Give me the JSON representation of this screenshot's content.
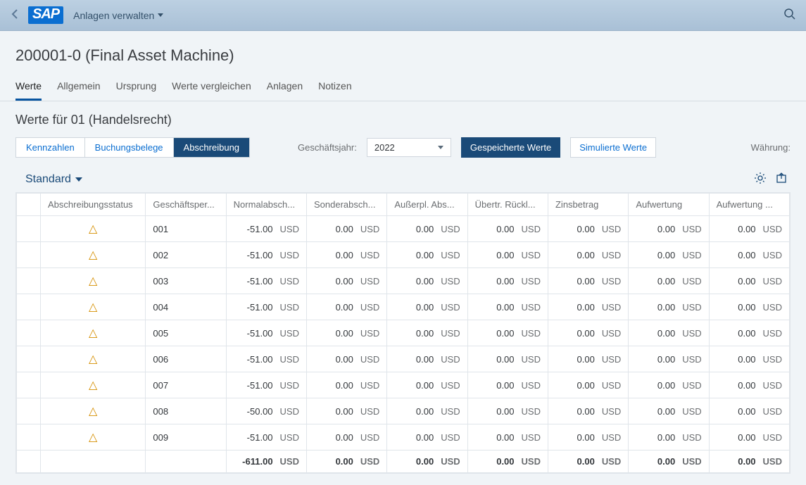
{
  "header": {
    "app_title": "Anlagen verwalten",
    "logo_text": "SAP"
  },
  "page_title": "200001-0 (Final Asset Machine)",
  "tabs": [
    {
      "id": "werte",
      "label": "Werte",
      "active": true
    },
    {
      "id": "allg",
      "label": "Allgemein",
      "active": false
    },
    {
      "id": "ursp",
      "label": "Ursprung",
      "active": false
    },
    {
      "id": "vgl",
      "label": "Werte vergleichen",
      "active": false
    },
    {
      "id": "anl",
      "label": "Anlagen",
      "active": false
    },
    {
      "id": "not",
      "label": "Notizen",
      "active": false
    }
  ],
  "section_title": "Werte für 01 (Handelsrecht)",
  "segments": [
    {
      "id": "kenn",
      "label": "Kennzahlen",
      "active": false
    },
    {
      "id": "buch",
      "label": "Buchungsbelege",
      "active": false
    },
    {
      "id": "absch",
      "label": "Abschreibung",
      "active": true
    }
  ],
  "fy": {
    "label": "Geschäftsjahr:",
    "value": "2022"
  },
  "value_modes": {
    "saved": "Gespeicherte Werte",
    "simulated": "Simulierte Werte"
  },
  "currency_label": "Währung:",
  "view": "Standard",
  "columns": [
    "",
    "Abschreibungsstatus",
    "Geschäftsper...",
    "Normalabsch...",
    "Sonderabsch...",
    "Außerpl. Abs...",
    "Übertr. Rückl...",
    "Zinsbetrag",
    "Aufwertung",
    "Aufwertung ..."
  ],
  "rows": [
    {
      "period": "001",
      "normal": "-51.00",
      "sonder": "0.00",
      "ausser": "0.00",
      "uebertr": "0.00",
      "zins": "0.00",
      "aufw": "0.00",
      "aufw2": "0.00",
      "c": "USD"
    },
    {
      "period": "002",
      "normal": "-51.00",
      "sonder": "0.00",
      "ausser": "0.00",
      "uebertr": "0.00",
      "zins": "0.00",
      "aufw": "0.00",
      "aufw2": "0.00",
      "c": "USD"
    },
    {
      "period": "003",
      "normal": "-51.00",
      "sonder": "0.00",
      "ausser": "0.00",
      "uebertr": "0.00",
      "zins": "0.00",
      "aufw": "0.00",
      "aufw2": "0.00",
      "c": "USD"
    },
    {
      "period": "004",
      "normal": "-51.00",
      "sonder": "0.00",
      "ausser": "0.00",
      "uebertr": "0.00",
      "zins": "0.00",
      "aufw": "0.00",
      "aufw2": "0.00",
      "c": "USD"
    },
    {
      "period": "005",
      "normal": "-51.00",
      "sonder": "0.00",
      "ausser": "0.00",
      "uebertr": "0.00",
      "zins": "0.00",
      "aufw": "0.00",
      "aufw2": "0.00",
      "c": "USD"
    },
    {
      "period": "006",
      "normal": "-51.00",
      "sonder": "0.00",
      "ausser": "0.00",
      "uebertr": "0.00",
      "zins": "0.00",
      "aufw": "0.00",
      "aufw2": "0.00",
      "c": "USD"
    },
    {
      "period": "007",
      "normal": "-51.00",
      "sonder": "0.00",
      "ausser": "0.00",
      "uebertr": "0.00",
      "zins": "0.00",
      "aufw": "0.00",
      "aufw2": "0.00",
      "c": "USD"
    },
    {
      "period": "008",
      "normal": "-50.00",
      "sonder": "0.00",
      "ausser": "0.00",
      "uebertr": "0.00",
      "zins": "0.00",
      "aufw": "0.00",
      "aufw2": "0.00",
      "c": "USD"
    },
    {
      "period": "009",
      "normal": "-51.00",
      "sonder": "0.00",
      "ausser": "0.00",
      "uebertr": "0.00",
      "zins": "0.00",
      "aufw": "0.00",
      "aufw2": "0.00",
      "c": "USD"
    }
  ],
  "totals": {
    "normal": "-611.00",
    "sonder": "0.00",
    "ausser": "0.00",
    "uebertr": "0.00",
    "zins": "0.00",
    "aufw": "0.00",
    "aufw2": "0.00",
    "c": "USD"
  }
}
